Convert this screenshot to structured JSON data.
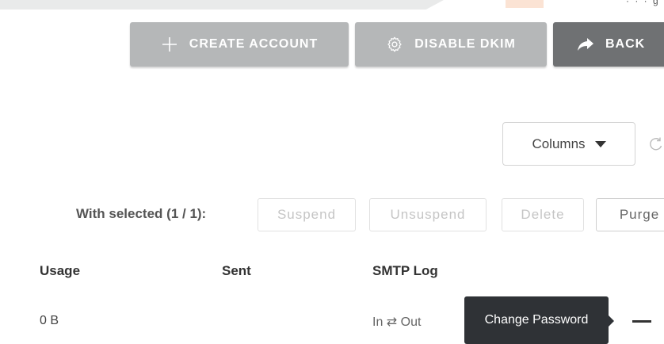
{
  "header": {
    "top_right_text": "· · · g"
  },
  "actions": {
    "create_account": "CREATE ACCOUNT",
    "disable_dkim": "DISABLE DKIM",
    "back": "BACK"
  },
  "table_controls": {
    "columns_label": "Columns"
  },
  "bulk": {
    "with_selected": "With selected (1 / 1):",
    "suspend": "Suspend",
    "unsuspend": "Unsuspend",
    "delete": "Delete",
    "purge": "Purge"
  },
  "table": {
    "columns": [
      "Usage",
      "Sent",
      "SMTP Log"
    ],
    "rows": [
      {
        "usage": "0 B",
        "sent": "",
        "smtp_log": "In ⇄ Out"
      }
    ]
  },
  "tooltip": {
    "text": "Change Password"
  },
  "colors": {
    "button_disabled": "#b5b7b8",
    "button_back": "#6f7173",
    "tooltip_bg": "#2f3236"
  }
}
